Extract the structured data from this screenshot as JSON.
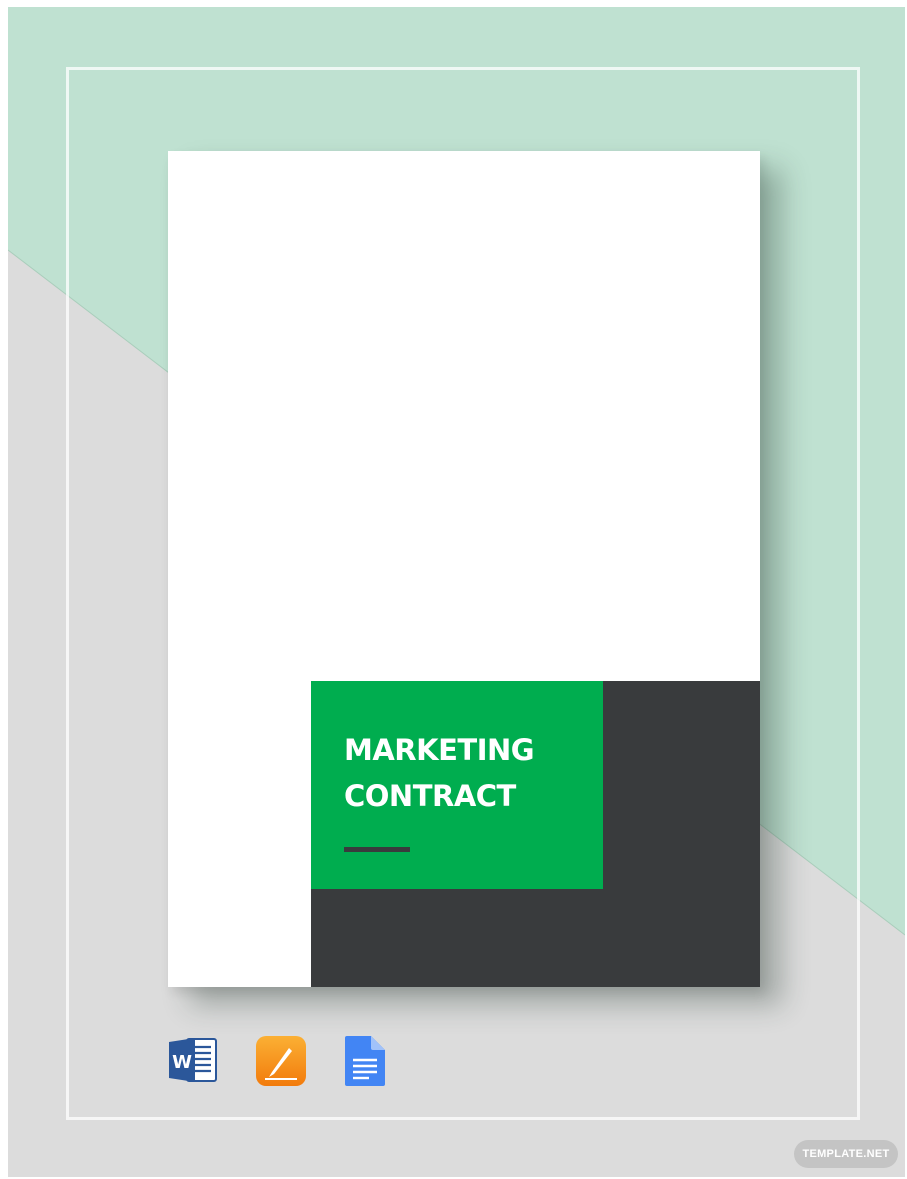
{
  "document": {
    "title_lines": [
      "MARKETING",
      "CONTRACT"
    ]
  },
  "formats": [
    {
      "name": "Microsoft Word",
      "icon": "word-icon",
      "letter": "W",
      "color": "#2b579a"
    },
    {
      "name": "Apple Pages",
      "icon": "pages-icon",
      "color": "#f7931e"
    },
    {
      "name": "Google Docs",
      "icon": "google-docs-icon",
      "color": "#4285f4"
    }
  ],
  "watermark": {
    "text": "TEMPLATE.NET"
  },
  "colors": {
    "mint": "#bfe1d1",
    "grey": "#dcdcdc",
    "accent_green": "#00ad4f",
    "charcoal": "#393b3d"
  }
}
